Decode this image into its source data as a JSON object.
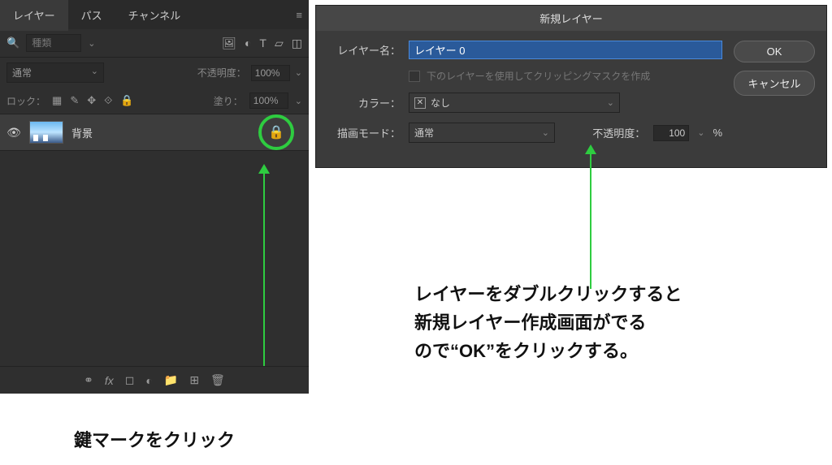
{
  "tabs": {
    "layers": "レイヤー",
    "paths": "パス",
    "channels": "チャンネル"
  },
  "search": {
    "placeholder": "種類"
  },
  "blend": {
    "mode": "通常",
    "opacity_label": "不透明度：",
    "opacity": "100%"
  },
  "lock": {
    "label": "ロック：",
    "fill_label": "塗り：",
    "fill": "100%"
  },
  "layer": {
    "name": "背景"
  },
  "caption_left": "鍵マークをクリック",
  "dialog": {
    "title": "新規レイヤー",
    "name_label": "レイヤー名：",
    "name_value": "レイヤー 0",
    "clip_text": "下のレイヤーを使用してクリッピングマスクを作成",
    "color_label": "カラー：",
    "color_value": "なし",
    "mode_label": "描画モード：",
    "mode_value": "通常",
    "opacity_label": "不透明度：",
    "opacity_value": "100",
    "pct": "%",
    "ok": "OK",
    "cancel": "キャンセル"
  },
  "caption_right": "レイヤーをダブルクリックすると\n新規レイヤー作成画面がでる\nので“OK”をクリックする。"
}
